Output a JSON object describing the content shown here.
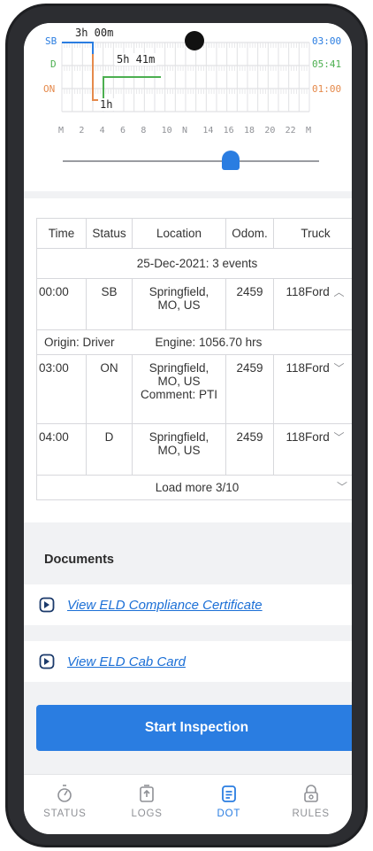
{
  "graph": {
    "rows": [
      {
        "code": "SB",
        "total": "03:00",
        "color": "#2a7de1"
      },
      {
        "code": "D",
        "total": "05:41",
        "color": "#4caf50"
      },
      {
        "code": "ON",
        "total": "01:00",
        "color": "#e58a4c"
      }
    ],
    "hour_labels": [
      "M",
      "2",
      "4",
      "6",
      "8",
      "10",
      "N",
      "14",
      "16",
      "18",
      "20",
      "22",
      "M"
    ],
    "annotations": {
      "sb": "3h 00m",
      "d": "5h 41m",
      "on": "1h"
    }
  },
  "table": {
    "headers": [
      "Time",
      "Status",
      "Location",
      "Odom.",
      "Truck"
    ],
    "date_summary": "25-Dec-2021: 3 events",
    "rows": [
      {
        "time": "00:00",
        "status": "SB",
        "location_line1": "Springfield,",
        "location_line2": "MO, US",
        "comment": "",
        "odom": "2459",
        "truck": "118Ford",
        "expanded": true
      },
      {
        "time": "03:00",
        "status": "ON",
        "location_line1": "Springfield,",
        "location_line2": "MO, US",
        "comment": "Comment: PTI",
        "odom": "2459",
        "truck": "118Ford",
        "expanded": false
      },
      {
        "time": "04:00",
        "status": "D",
        "location_line1": "Springfield,",
        "location_line2": "MO, US",
        "comment": "",
        "odom": "2459",
        "truck": "118Ford",
        "expanded": false
      }
    ],
    "meta": {
      "origin": "Origin: Driver",
      "engine": "Engine: 1056.70 hrs"
    },
    "load_more": "Load more 3/10"
  },
  "documents": {
    "title": "Documents",
    "links": [
      "View ELD Compliance Certificate",
      "View ELD Cab Card"
    ]
  },
  "start_inspection": "Start Inspection",
  "nav": [
    {
      "label": "STATUS",
      "icon": "status-icon",
      "active": false
    },
    {
      "label": "LOGS",
      "icon": "logs-icon",
      "active": false
    },
    {
      "label": "DOT",
      "icon": "dot-icon",
      "active": true
    },
    {
      "label": "RULES",
      "icon": "rules-icon",
      "active": false
    }
  ],
  "colors": {
    "accent": "#2a7de1",
    "link": "#1b6fd6",
    "on_duty": "#e58a4c",
    "driving": "#4caf50"
  }
}
